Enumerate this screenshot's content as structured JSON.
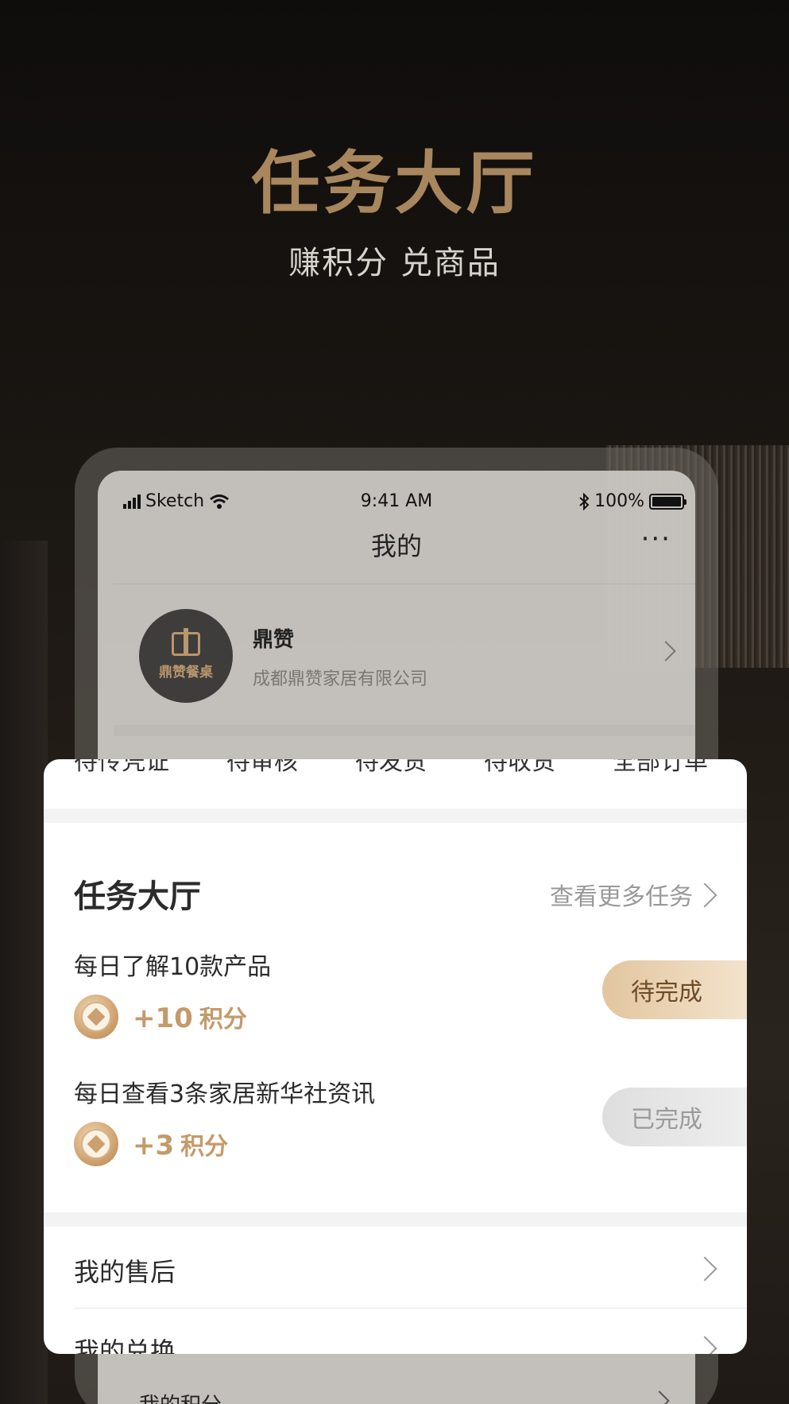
{
  "hero": {
    "title": "任务大厅",
    "subtitle": "赚积分 兑商品"
  },
  "phone": {
    "status": {
      "carrier": "Sketch",
      "time": "9:41 AM",
      "battery": "100%"
    },
    "nav": {
      "title": "我的",
      "more": "···"
    },
    "profile": {
      "logo_text": "鼎赞餐桌",
      "name": "鼎赞",
      "company": "成都鼎赞家居有限公司"
    },
    "below_item": "我的积分"
  },
  "card": {
    "order_tabs": [
      "待传凭证",
      "待审核",
      "待发货",
      "待收货",
      "全部订单"
    ],
    "task_hall": {
      "title": "任务大厅",
      "more": "查看更多任务"
    },
    "tasks": [
      {
        "name": "每日了解10款产品",
        "points": "+10",
        "unit": "积分",
        "status": "待完成"
      },
      {
        "name": "每日查看3条家居新华社资讯",
        "points": "+3",
        "unit": "积分",
        "status": "已完成"
      }
    ],
    "menu": [
      {
        "label": "我的售后"
      },
      {
        "label": "我的兑换"
      }
    ]
  },
  "colors": {
    "accent_gold": "#a8865e",
    "points_gold": "#c49a6a",
    "pending_pill": "#e2c59f",
    "done_pill": "#dedede"
  }
}
